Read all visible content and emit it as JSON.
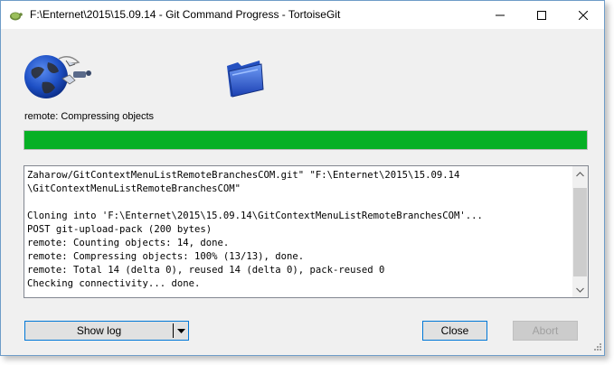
{
  "window": {
    "title": "F:\\Enternet\\2015\\15.09.14 - Git Command Progress - TortoiseGit"
  },
  "status": {
    "text": "remote: Compressing objects"
  },
  "progress": {
    "fraction": 1.0,
    "color": "#06b025"
  },
  "log": {
    "text": "Zaharow/GitContextMenuListRemoteBranchesCOM.git\" \"F:\\Enternet\\2015\\15.09.14\n\\GitContextMenuListRemoteBranchesCOM\"\n\nCloning into 'F:\\Enternet\\2015\\15.09.14\\GitContextMenuListRemoteBranchesCOM'...\nPOST git-upload-pack (200 bytes)\nremote: Counting objects: 14, done.\nremote: Compressing objects: 100% (13/13), done.\nremote: Total 14 (delta 0), reused 14 (delta 0), pack-reused 0\nChecking connectivity... done."
  },
  "buttons": {
    "show_log": "Show log",
    "close": "Close",
    "abort": "Abort"
  },
  "icons": {
    "app": "tortoisegit-icon",
    "minimize": "minimize-icon",
    "maximize": "maximize-icon",
    "close": "close-icon",
    "globe": "globe-animation-icon",
    "folder": "folder-icon",
    "dropdown": "chevron-down-icon"
  },
  "colors": {
    "accent": "#0078d7",
    "progress": "#06b025"
  }
}
